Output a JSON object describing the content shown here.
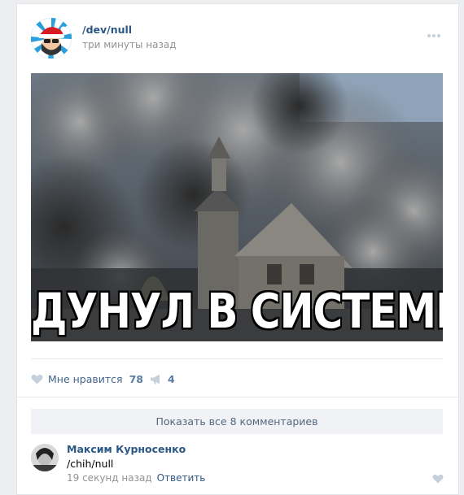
{
  "post": {
    "author": "/dev/null",
    "time": "три минуты назад",
    "image": {
      "caption": "ДУНУЛ В СИСТЕМНИК"
    }
  },
  "actions": {
    "like_label": "Мне нравится",
    "like_count": "78",
    "share_count": "4"
  },
  "comments": {
    "show_all_label": "Показать все 8 комментариев",
    "items": [
      {
        "author": "Максим Курносенко",
        "text": "/chih/null",
        "time": "19 секунд назад",
        "reply_label": "Ответить"
      }
    ]
  },
  "colors": {
    "link": "#2a5885",
    "meta": "#939393",
    "icon": "#c5d0db",
    "action": "#42648b"
  },
  "icons": [
    "more-icon",
    "heart-icon",
    "megaphone-icon",
    "comment-heart-icon"
  ]
}
